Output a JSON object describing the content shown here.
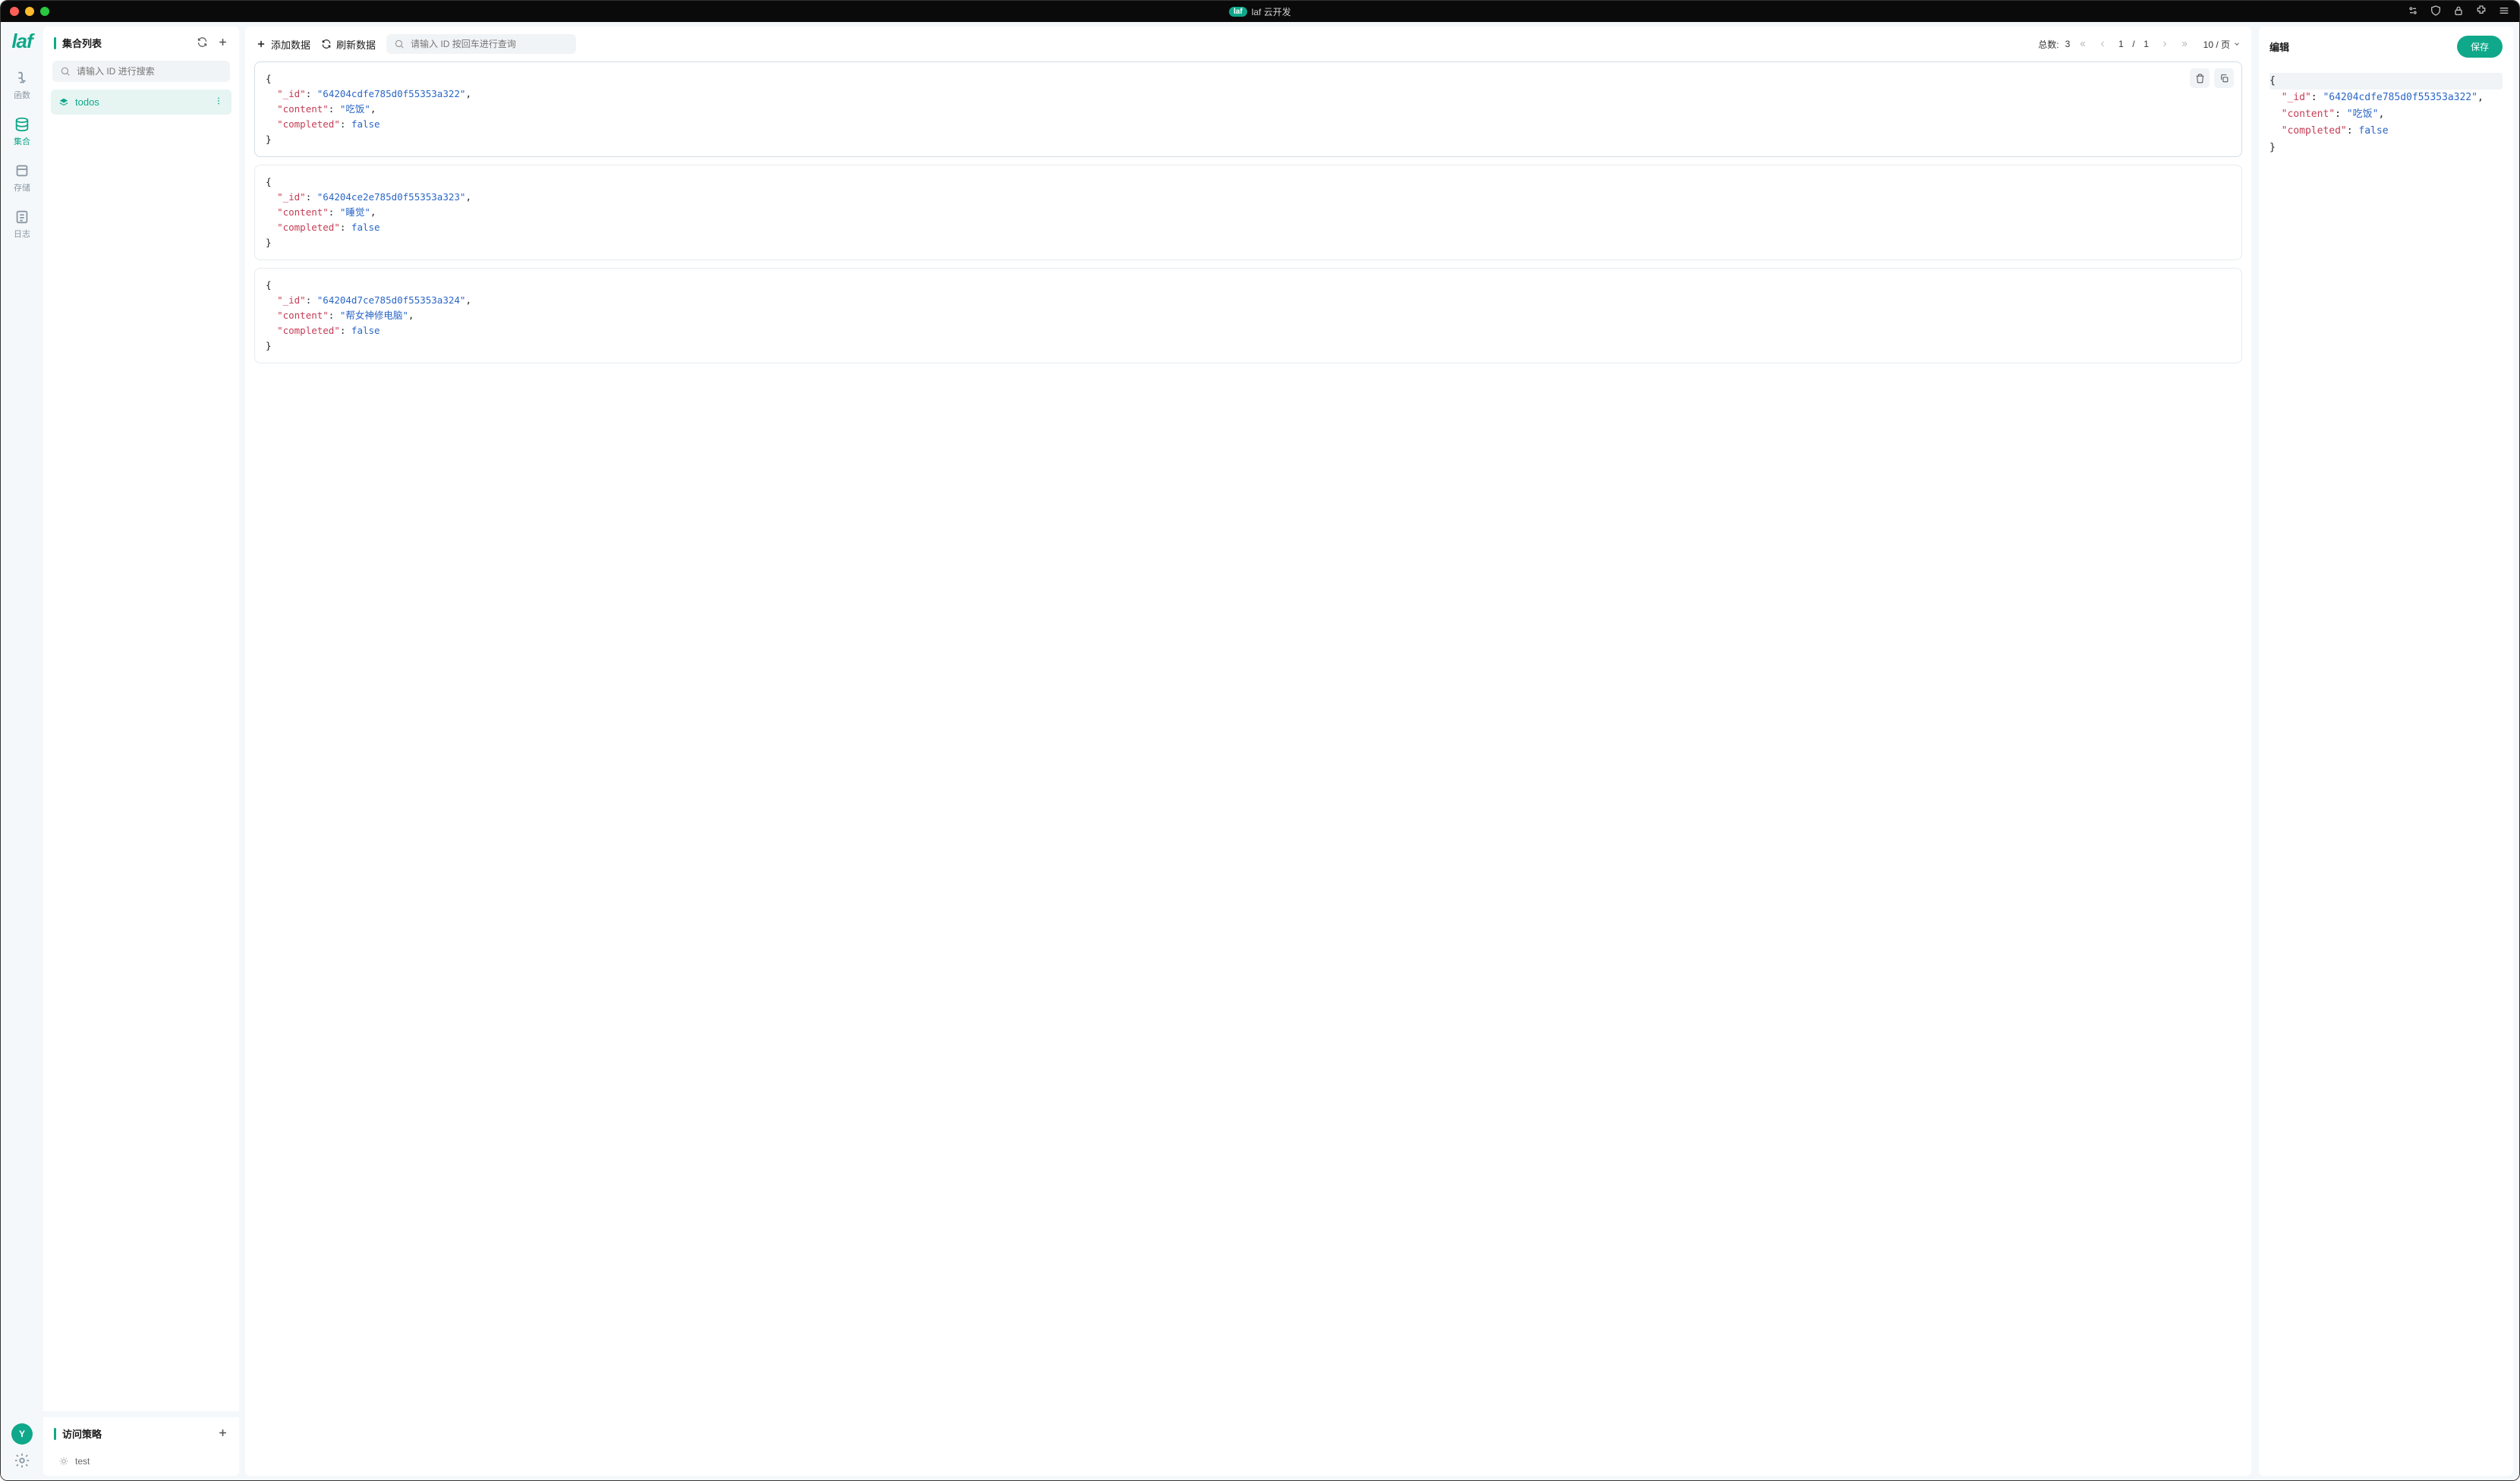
{
  "window": {
    "title": "laf 云开发",
    "badge": "laf"
  },
  "logo": "laf",
  "nav": {
    "functions": "函数",
    "collections": "集合",
    "storage": "存储",
    "logs": "日志"
  },
  "avatar_initial": "Y",
  "side": {
    "collections_title": "集合列表",
    "search_placeholder": "请输入 ID 进行搜索",
    "items": [
      {
        "name": "todos"
      }
    ],
    "policy_title": "访问策略",
    "policies": [
      {
        "name": "test"
      }
    ]
  },
  "toolbar": {
    "add_data": "添加数据",
    "refresh": "刷新数据",
    "search_placeholder": "请输入 ID 按回车进行查询"
  },
  "pager": {
    "total_label": "总数:",
    "total": "3",
    "current": "1",
    "sep": "/",
    "pages": "1",
    "page_size": "10 / 页"
  },
  "records": [
    {
      "_id": "64204cdfe785d0f55353a322",
      "content": "吃饭",
      "completed": "false"
    },
    {
      "_id": "64204ce2e785d0f55353a323",
      "content": "睡觉",
      "completed": "false"
    },
    {
      "_id": "64204d7ce785d0f55353a324",
      "content": "帮女神修电脑",
      "completed": "false"
    }
  ],
  "record_keys": {
    "id": "\"_id\"",
    "content": "\"content\"",
    "completed": "\"completed\""
  },
  "editor": {
    "title": "编辑",
    "save": "保存",
    "doc": {
      "_id": "64204cdfe785d0f55353a322",
      "content": "吃饭",
      "completed": "false"
    }
  }
}
